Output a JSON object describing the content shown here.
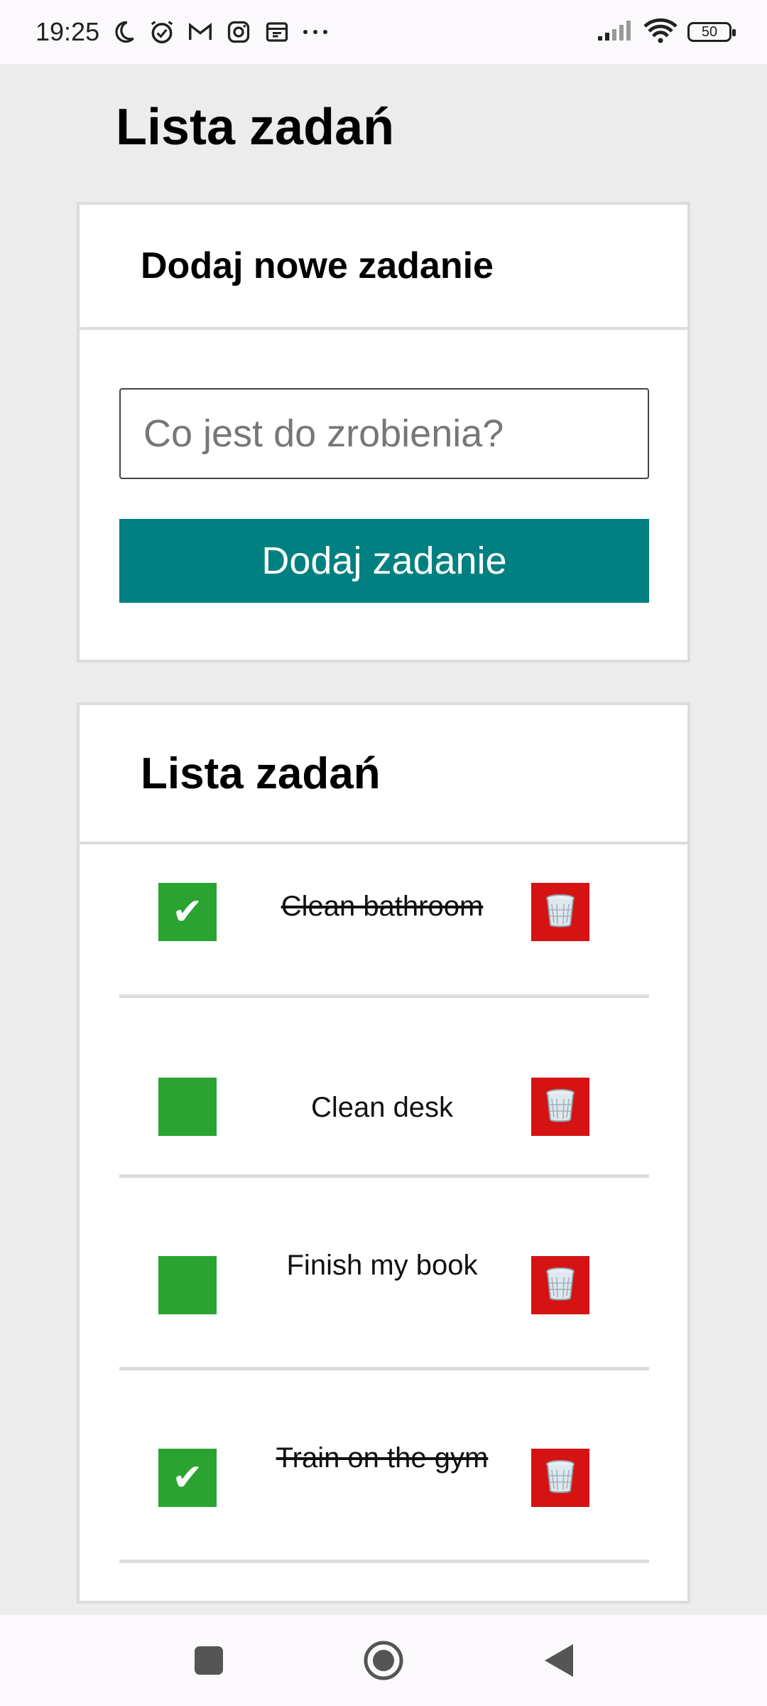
{
  "status_bar": {
    "time": "19:25",
    "battery": "50",
    "icons": [
      "moon-icon",
      "alarm-icon",
      "gmail-icon",
      "instagram-icon",
      "calendar-icon",
      "more-dots-icon",
      "signal-icon",
      "wifi-icon",
      "battery-icon"
    ]
  },
  "page": {
    "title": "Lista zadań"
  },
  "add_card": {
    "title": "Dodaj nowe zadanie",
    "input_placeholder": "Co jest do zrobienia?",
    "input_value": "",
    "button_label": "Dodaj zadanie"
  },
  "list_card": {
    "title": "Lista zadań",
    "tasks": [
      {
        "label": "Clean bathroom",
        "done": true
      },
      {
        "label": "Clean desk",
        "done": false
      },
      {
        "label": "Finish my book",
        "done": false
      },
      {
        "label": "Train on the gym",
        "done": true
      }
    ],
    "check_mark": "✔"
  },
  "colors": {
    "accent": "#008080",
    "checkbox": "#2ba331",
    "delete": "#d51313",
    "background": "#ececec"
  },
  "nav_bar": {
    "buttons": [
      "recent-apps-icon",
      "home-icon",
      "back-icon"
    ]
  }
}
